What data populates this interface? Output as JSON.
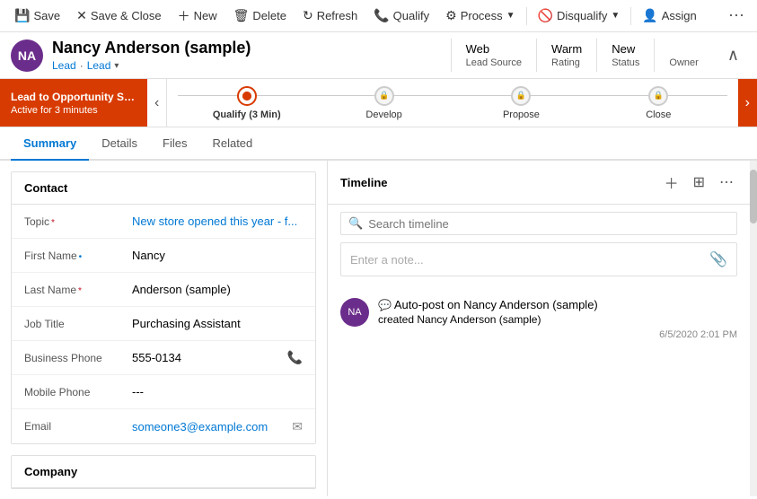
{
  "toolbar": {
    "save_label": "Save",
    "save_close_label": "Save & Close",
    "new_label": "New",
    "delete_label": "Delete",
    "refresh_label": "Refresh",
    "qualify_label": "Qualify",
    "process_label": "Process",
    "disqualify_label": "Disqualify",
    "assign_label": "Assign"
  },
  "header": {
    "avatar_initials": "NA",
    "name": "Nancy Anderson (sample)",
    "type1": "Lead",
    "type2": "Lead",
    "meta": [
      {
        "value": "Web",
        "label": "Lead Source"
      },
      {
        "value": "Warm",
        "label": "Rating"
      },
      {
        "value": "New",
        "label": "Status"
      },
      {
        "value": "",
        "label": "Owner"
      }
    ]
  },
  "stage_bar": {
    "promo_title": "Lead to Opportunity Sale...",
    "promo_sub": "Active for 3 minutes",
    "stages": [
      {
        "label": "Qualify (3 Min)",
        "state": "active",
        "locked": false
      },
      {
        "label": "Develop",
        "state": "upcoming",
        "locked": true
      },
      {
        "label": "Propose",
        "state": "upcoming",
        "locked": true
      },
      {
        "label": "Close",
        "state": "upcoming",
        "locked": true
      }
    ]
  },
  "tabs": [
    {
      "label": "Summary",
      "active": true
    },
    {
      "label": "Details",
      "active": false
    },
    {
      "label": "Files",
      "active": false
    },
    {
      "label": "Related",
      "active": false
    }
  ],
  "contact_section": {
    "title": "Contact",
    "fields": [
      {
        "label": "Topic",
        "required": true,
        "value": "New store opened this year - f...",
        "action": ""
      },
      {
        "label": "First Name",
        "required": false,
        "value": "Nancy",
        "action": ""
      },
      {
        "label": "Last Name",
        "required": true,
        "value": "Anderson (sample)",
        "action": ""
      },
      {
        "label": "Job Title",
        "required": false,
        "value": "Purchasing Assistant",
        "action": ""
      },
      {
        "label": "Business Phone",
        "required": false,
        "value": "555-0134",
        "action": "phone"
      },
      {
        "label": "Mobile Phone",
        "required": false,
        "value": "---",
        "action": ""
      },
      {
        "label": "Email",
        "required": false,
        "value": "someone3@example.com",
        "action": "email"
      }
    ]
  },
  "company_section": {
    "title": "Company"
  },
  "timeline": {
    "title": "Timeline",
    "search_placeholder": "Search timeline",
    "note_placeholder": "Enter a note...",
    "items": [
      {
        "avatar_initials": "NA",
        "post_title": "Auto-post on Nancy Anderson (sample)",
        "post_sub_prefix": "created",
        "post_sub_value": "Nancy Anderson (sample)",
        "date": "6/5/2020 2:01 PM"
      }
    ]
  }
}
